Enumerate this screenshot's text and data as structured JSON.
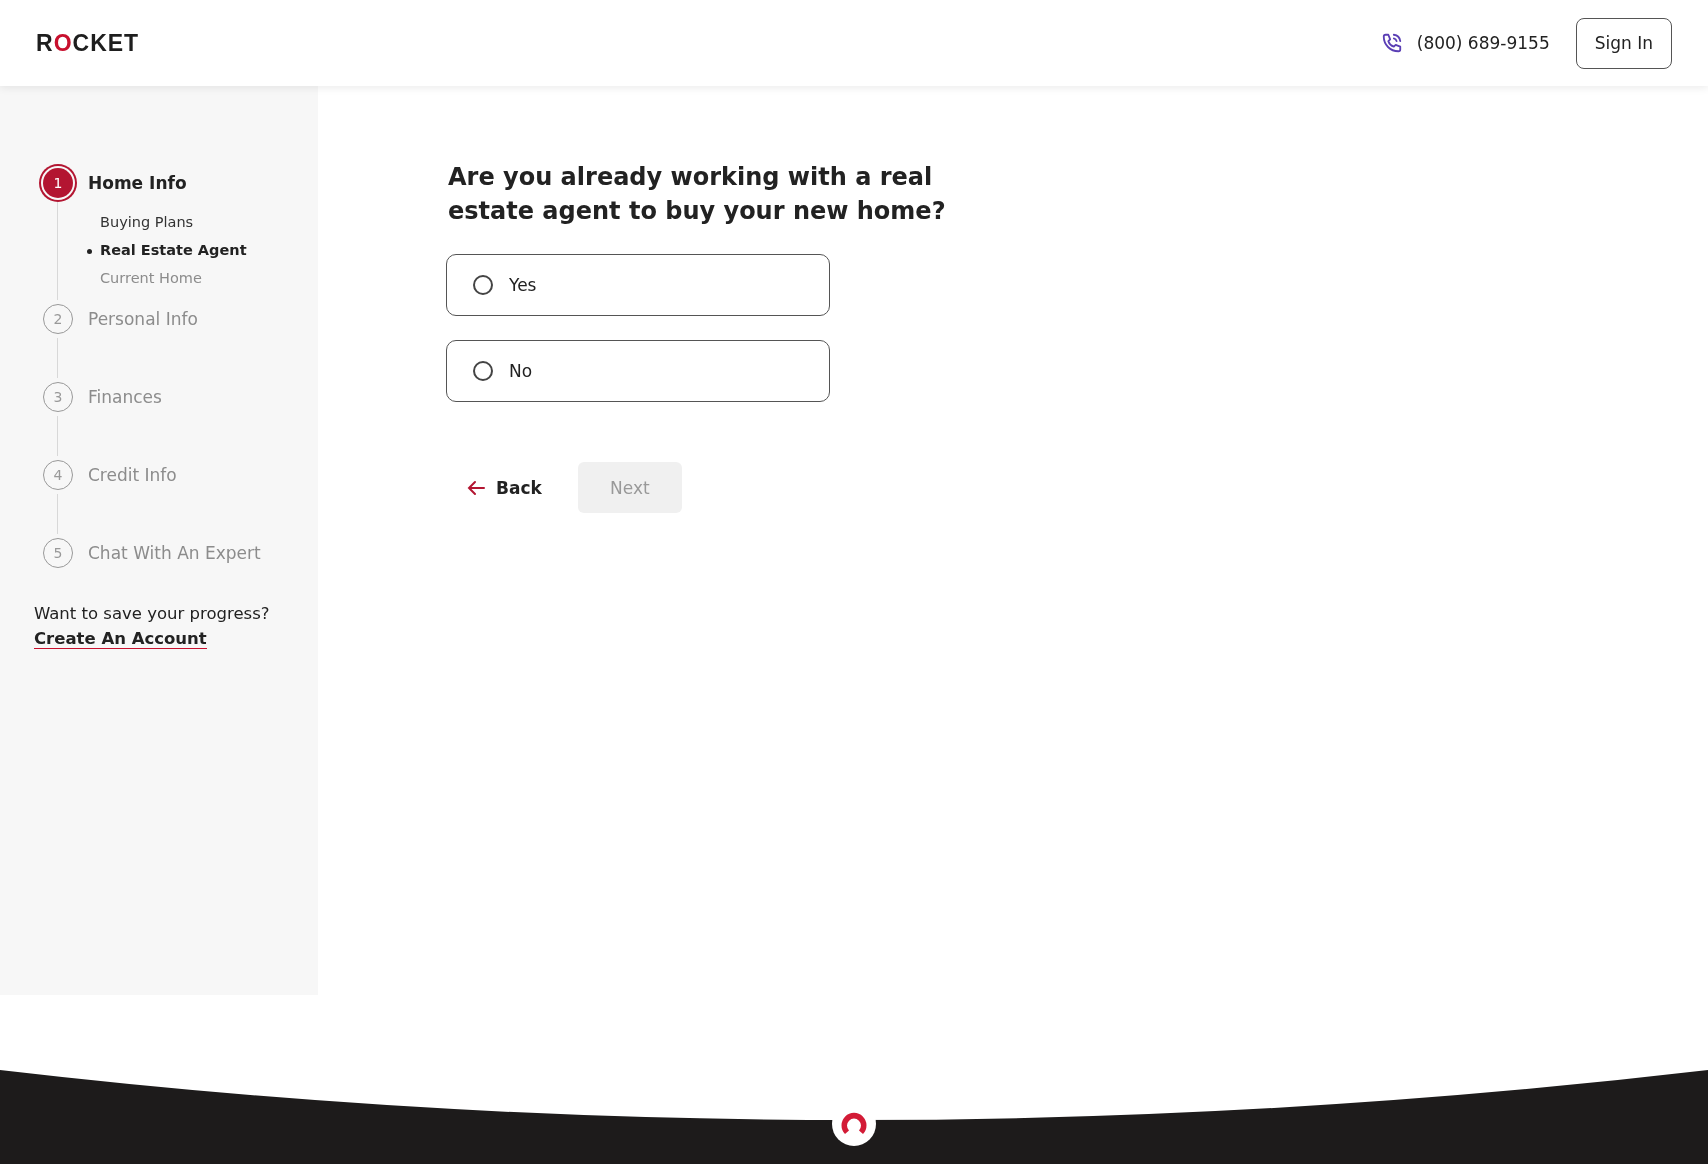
{
  "header": {
    "logo": "ROCKET",
    "phone": "(800) 689-9155",
    "sign_in": "Sign In"
  },
  "steps": [
    {
      "number": "1",
      "label": "Home Info",
      "selected": true,
      "children": [
        {
          "label": "Buying Plans",
          "kind": "done"
        },
        {
          "label": "Real Estate Agent",
          "kind": "current"
        },
        {
          "label": "Current Home",
          "kind": "pending"
        }
      ]
    },
    {
      "number": "2",
      "label": "Personal Info",
      "selected": false
    },
    {
      "number": "3",
      "label": "Finances",
      "selected": false
    },
    {
      "number": "4",
      "label": "Credit Info",
      "selected": false
    },
    {
      "number": "5",
      "label": "Chat With An Expert",
      "selected": false
    }
  ],
  "save_prompt": {
    "text": "Want to save your progress?",
    "link": "Create An Account"
  },
  "question": "Are you already working with a real estate agent to buy your new home?",
  "options": [
    {
      "label": "Yes",
      "selected": false
    },
    {
      "label": "No",
      "selected": false
    }
  ],
  "actions": {
    "back": "Back",
    "next": {
      "label": "Next",
      "disabled": true
    }
  }
}
